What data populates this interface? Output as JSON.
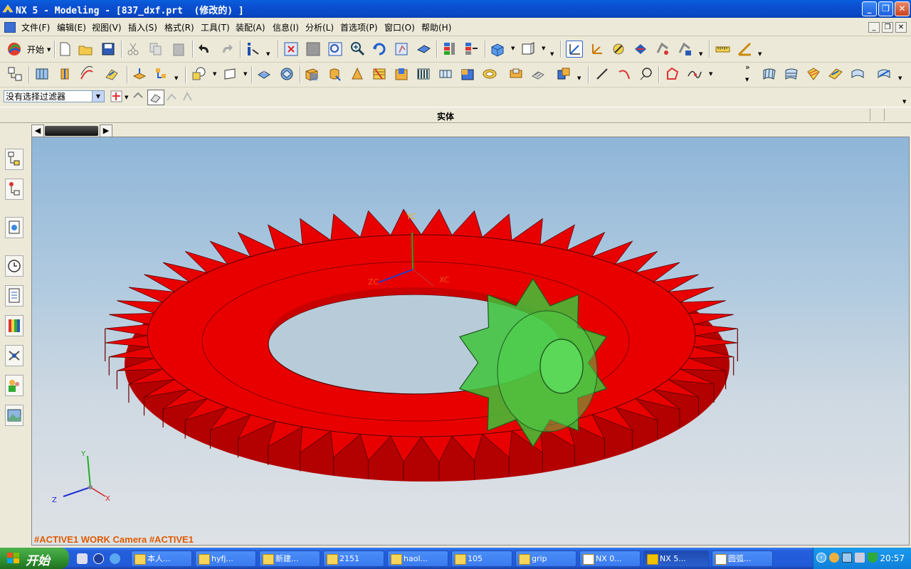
{
  "window": {
    "title": "NX 5 - Modeling - [837_dxf.prt  (修改的) ]"
  },
  "menu": [
    "文件(F)",
    "编辑(E)",
    "视图(V)",
    "插入(S)",
    "格式(R)",
    "工具(T)",
    "装配(A)",
    "信息(I)",
    "分析(L)",
    "首选项(P)",
    "窗口(O)",
    "帮助(H)"
  ],
  "toolbar": {
    "start_label": "开始"
  },
  "selection": {
    "filter_value": "没有选择过滤器"
  },
  "cue": {
    "label": "实体"
  },
  "viewport": {
    "status_text": "#ACTIVE1 WORK Camera #ACTIVE1",
    "wcs_labels": {
      "xc": "XC",
      "yc": "YC",
      "zc": "ZC"
    },
    "triad_labels": {
      "x": "X",
      "y": "Y",
      "z": "Z"
    },
    "colors": {
      "ring_gear": "#E80000",
      "pinion": "#3DC43A",
      "background_top": "#8FB6D8",
      "background_bottom": "#DEE2E6"
    }
  },
  "taskbar": {
    "start_label": "开始",
    "items": [
      "本人...",
      "hyfj...",
      "新建...",
      "2151",
      "haol...",
      "105",
      "grip",
      "NX 0...",
      "NX 5...",
      "圆弧..."
    ],
    "clock": "20:57"
  }
}
